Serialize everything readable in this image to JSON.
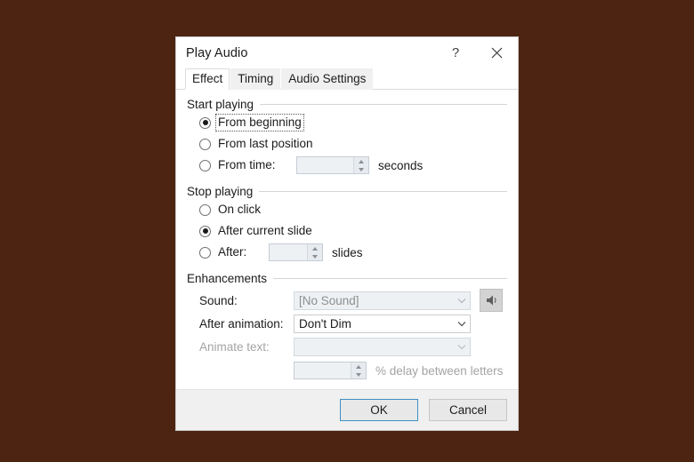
{
  "window": {
    "title": "Play Audio",
    "help_icon": "question-mark-icon",
    "help_label": "?",
    "close_icon": "close-icon"
  },
  "tabs": [
    {
      "label": "Effect",
      "active": true
    },
    {
      "label": "Timing",
      "active": false
    },
    {
      "label": "Audio Settings",
      "active": false
    }
  ],
  "groups": {
    "start_playing": {
      "title": "Start playing",
      "options": [
        {
          "label": "From beginning",
          "accel": "b",
          "selected": true,
          "focused": true
        },
        {
          "label": "From last position",
          "accel": "l",
          "selected": false,
          "focused": false
        },
        {
          "label": "From time:",
          "accel": "m",
          "selected": false,
          "focused": false
        }
      ],
      "time_spinner": {
        "value": "",
        "enabled": false
      },
      "time_unit": "seconds"
    },
    "stop_playing": {
      "title": "Stop playing",
      "options": [
        {
          "label": "On click",
          "accel": "k",
          "selected": false,
          "focused": false
        },
        {
          "label": "After current slide",
          "accel": "c",
          "selected": true,
          "focused": false
        },
        {
          "label": "After:",
          "accel": "f",
          "selected": false,
          "focused": false
        }
      ],
      "slides_spinner": {
        "value": "",
        "enabled": false
      },
      "slides_unit": "slides"
    },
    "enhancements": {
      "title": "Enhancements",
      "sound": {
        "label": "Sound:",
        "accel": "S",
        "value": "[No Sound]",
        "enabled": false,
        "button_icon": "speaker-icon"
      },
      "after_animation": {
        "label": "After animation:",
        "accel": "A",
        "value": "Don't Dim",
        "enabled": true
      },
      "animate_text": {
        "label": "Animate text:",
        "accel": "x",
        "value": "",
        "enabled": false
      },
      "delay": {
        "spinner": {
          "value": "",
          "enabled": false
        },
        "label": "% delay between letters",
        "accel": "d",
        "enabled": false
      }
    }
  },
  "footer": {
    "ok_label": "OK",
    "cancel_label": "Cancel"
  },
  "colors": {
    "background": "#4d2411",
    "dialog": "#ffffff",
    "footer": "#f0f0f0",
    "default_button_border": "#3f8fc4",
    "disabled_text": "#a4a4a4"
  }
}
